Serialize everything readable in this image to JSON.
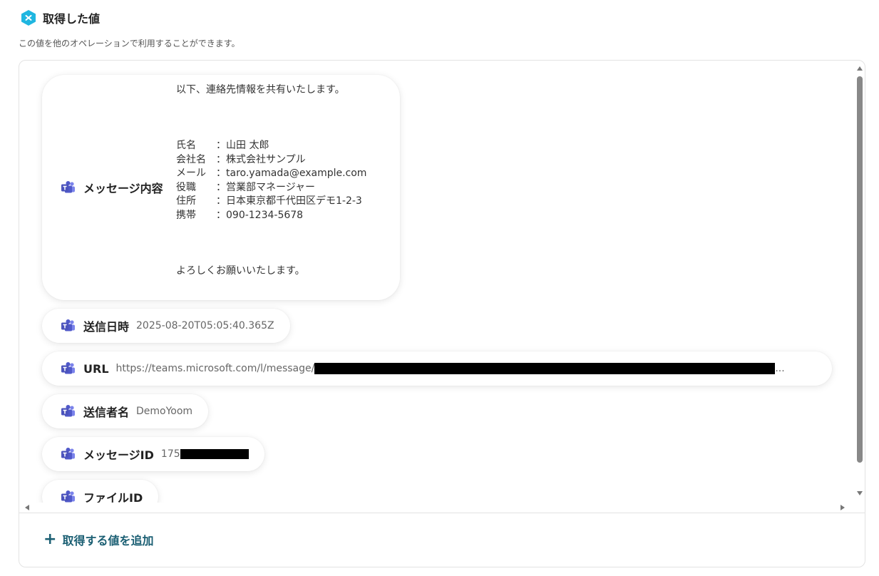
{
  "header": {
    "title": "取得した値",
    "subtitle": "この値を他のオペレーションで利用することができます。"
  },
  "fields": {
    "message": {
      "label": "メッセージ内容",
      "lines": [
        "以下、連絡先情報を共有いたします。",
        "",
        "",
        "",
        "氏名　　：山田 太郎",
        "会社名　：株式会社サンプル",
        "メール　：taro.yamada@example.com",
        "役職　　：営業部マネージャー",
        "住所　　：日本東京都千代田区デモ1-2-3",
        "携帯　　：090-1234-5678",
        "",
        "",
        "",
        "よろしくお願いいたします。"
      ]
    },
    "sent_at": {
      "label": "送信日時",
      "value": "2025-08-20T05:05:40.365Z"
    },
    "url": {
      "label": "URL",
      "value": "https://teams.microsoft.com/l/message/",
      "ellipsis": "..."
    },
    "sender": {
      "label": "送信者名",
      "value": "DemoYoom"
    },
    "message_id": {
      "label": "メッセージID",
      "value": "175"
    },
    "file_id": {
      "label": "ファイルID"
    }
  },
  "actions": {
    "add_label": "取得する値を追加",
    "add_icon": "plus-icon"
  },
  "colors": {
    "accent": "#1b5f73",
    "logo": "#1fb6e0",
    "teams": "#5059c9"
  }
}
